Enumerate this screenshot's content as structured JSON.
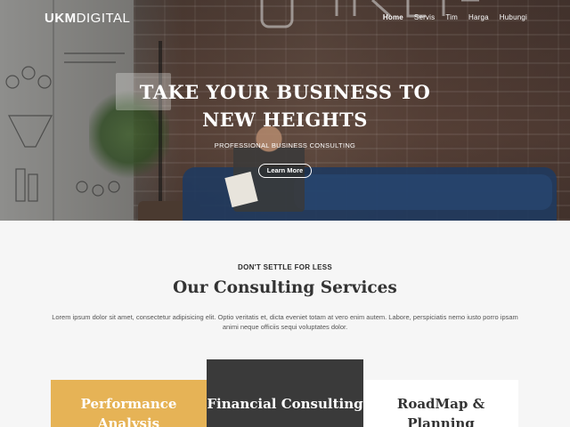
{
  "brand": {
    "logo_part1": "UKM",
    "logo_part2": "DIGITAL"
  },
  "nav": {
    "items": [
      {
        "label": "Home",
        "active": true
      },
      {
        "label": "Servis"
      },
      {
        "label": "Tim"
      },
      {
        "label": "Harga"
      },
      {
        "label": "Hubungi"
      }
    ]
  },
  "hero": {
    "title_line1": "TAKE YOUR BUSINESS TO",
    "title_line2": "NEW HEIGHTS",
    "subtitle": "PROFESSIONAL BUSINESS CONSULTING",
    "cta_label": "Learn More"
  },
  "services": {
    "kicker": "DON'T SETTLE FOR LESS",
    "title": "Our Consulting Services",
    "lead": "Lorem ipsum dolor sit amet, consectetur adipisicing elit. Optio veritatis et, dicta eveniet totam at vero enim autem. Labore, perspiciatis nemo iusto porro ipsam animi neque officiis sequi voluptates dolor.",
    "cards": [
      {
        "title": "Performance Analysis",
        "color": "#e6b356"
      },
      {
        "title": "Financial Consulting",
        "color": "#3a3a3a"
      },
      {
        "title": "RoadMap & Planning",
        "color": "#ffffff"
      }
    ]
  }
}
